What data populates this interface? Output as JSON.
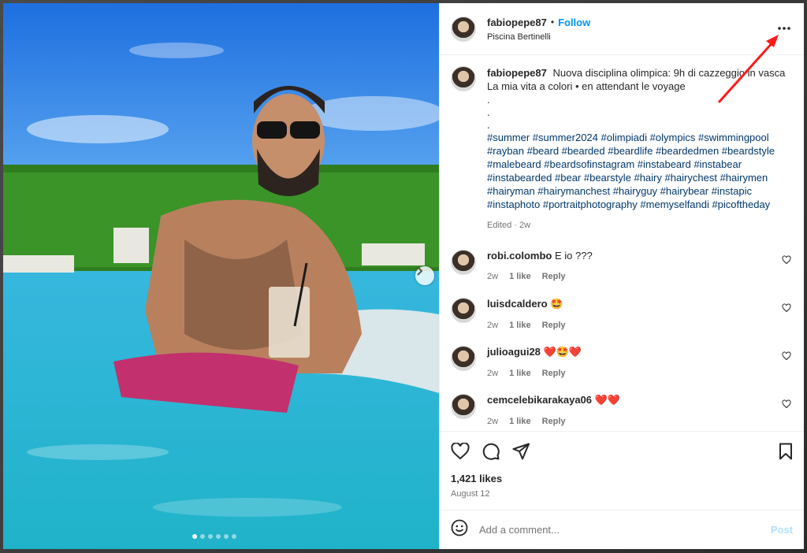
{
  "post": {
    "username": "fabiopepe87",
    "separator": "•",
    "follow_label": "Follow",
    "location": "Piscina Bertinelli",
    "more_label": "•••",
    "caption": {
      "username": "fabiopepe87",
      "line1": "Nuova disciplina olimpica: 9h di cazzeggio in vasca",
      "line2": "La mia vita a colori • en attendant le voyage",
      "dots": [
        ".",
        ".",
        "."
      ],
      "hashtags": "#summer #summer2024 #olimpiadi #olympics #swimmingpool #rayban #beard #bearded #beardlife #beardedmen #beardstyle #malebeard #beardsofinstagram #instabeard #instabear #instabearded #bear #bearstyle #hairy #hairychest #hairymen #hairyman #hairymanchest #hairyguy #hairybear #instapic #instaphoto #portraitphotography #memyselfandi #picoftheday",
      "edited": "Edited · 2w"
    },
    "comments": [
      {
        "username": "robi.colombo",
        "text": "E io ???",
        "time": "2w",
        "likes": "1 like",
        "reply": "Reply"
      },
      {
        "username": "luisdcaldero",
        "text": "🤩",
        "time": "2w",
        "likes": "1 like",
        "reply": "Reply"
      },
      {
        "username": "julioagui28",
        "text": "❤️🤩❤️",
        "time": "2w",
        "likes": "1 like",
        "reply": "Reply"
      },
      {
        "username": "cemcelebikarakaya06",
        "text": "❤️❤️",
        "time": "2w",
        "likes": "1 like",
        "reply": "Reply"
      }
    ],
    "likes_count": "1,421 likes",
    "date": "August 12",
    "comment_placeholder": "Add a comment...",
    "post_label": "Post"
  },
  "colors": {
    "accent": "#0095f6",
    "link": "#00376b",
    "muted": "#737373",
    "annotation_arrow": "#ff1a1a"
  },
  "icons": {
    "like": "heart-icon",
    "comment": "comment-bubble-icon",
    "share": "paper-plane-icon",
    "save": "bookmark-icon",
    "emoji": "smiley-icon",
    "next": "chevron-right-icon"
  },
  "carousel": {
    "slides": 6,
    "active_slide": 1
  }
}
